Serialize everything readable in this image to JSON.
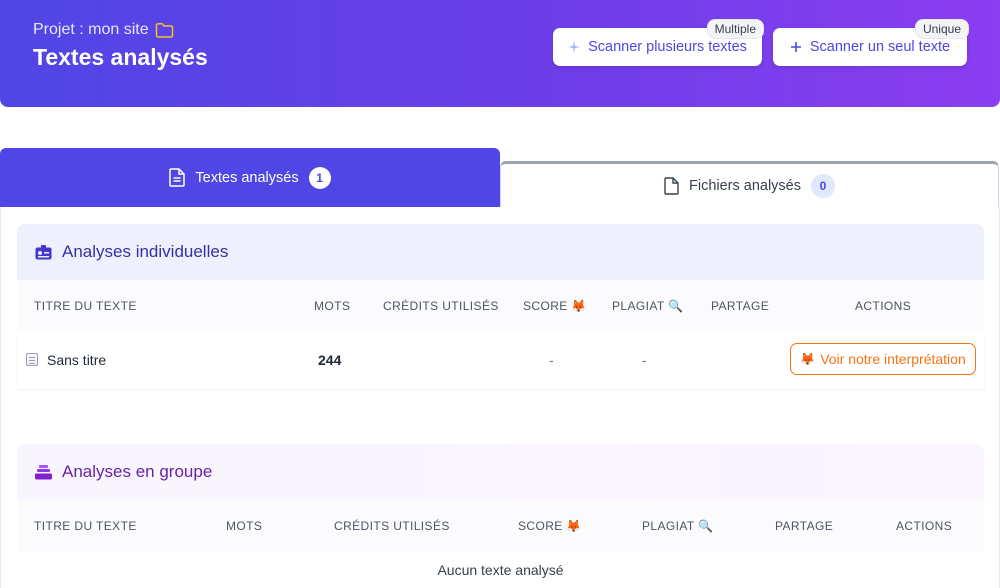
{
  "header": {
    "project_label": "Projet : mon site",
    "title": "Textes analysés",
    "btn_multi_label": "Scanner plusieurs textes",
    "btn_multi_tag": "Multiple",
    "btn_single_label": "Scanner un seul texte",
    "btn_single_tag": "Unique"
  },
  "tabs": [
    {
      "label": "Textes analysés",
      "count": "1",
      "active": true
    },
    {
      "label": "Fichiers analysés",
      "count": "0",
      "active": false
    }
  ],
  "individual": {
    "title": "Analyses individuelles",
    "columns": [
      "TITRE DU TEXTE",
      "MOTS",
      "CRÉDITS UTILISÉS",
      "SCORE 🦊",
      "PLAGIAT 🔍",
      "PARTAGE",
      "ACTIONS"
    ],
    "rows": [
      {
        "title": "Sans titre",
        "words": "244",
        "credits": "",
        "score": "-",
        "plagiat": "-",
        "partage": "",
        "action": "Voir notre interprétation"
      }
    ]
  },
  "group": {
    "title": "Analyses en groupe",
    "columns": [
      "TITRE DU TEXTE",
      "MOTS",
      "CRÉDITS UTILISÉS",
      "SCORE 🦊",
      "PLAGIAT 🔍",
      "PARTAGE",
      "ACTIONS"
    ],
    "empty": "Aucun texte analysé"
  },
  "colors": {
    "primary": "#4f46e5",
    "accent_orange": "#f97316",
    "group_purple": "#6b21a8"
  }
}
